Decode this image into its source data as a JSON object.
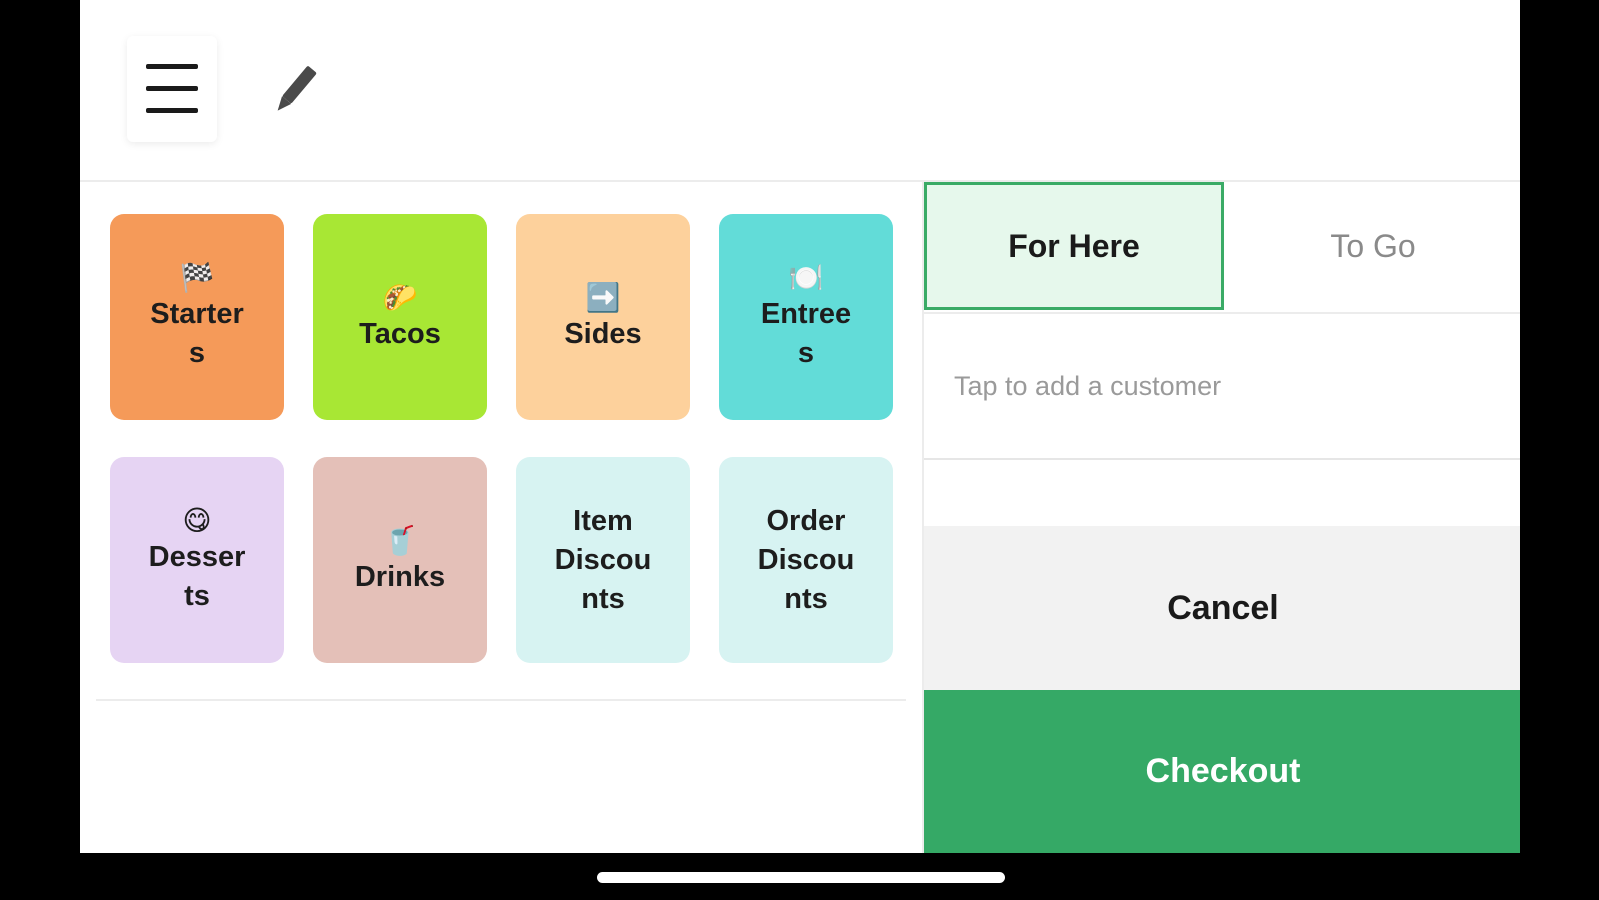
{
  "header": {
    "menu_icon": "hamburger-menu-icon",
    "edit_icon": "pencil-icon"
  },
  "tiles": [
    {
      "emoji": "🏁",
      "label": "Starter\ns",
      "color": "#f59a59"
    },
    {
      "emoji": "🌮",
      "label": "Tacos",
      "color": "#a8e734"
    },
    {
      "emoji": "➡️",
      "label": "Sides",
      "color": "#fdd19c"
    },
    {
      "emoji": "🍽️",
      "label": "Entree\ns",
      "color": "#62dcd8"
    },
    {
      "emoji": "😋",
      "label": "Desser\nts",
      "color": "#e6d4f3"
    },
    {
      "emoji": "🥤",
      "label": "Drinks",
      "color": "#e4c0b8"
    },
    {
      "emoji": "",
      "label": "Item\nDiscou\nnts",
      "color": "#d7f3f2"
    },
    {
      "emoji": "",
      "label": "Order\nDiscou\nnts",
      "color": "#d7f3f2"
    }
  ],
  "order": {
    "for_here_label": "For Here",
    "to_go_label": "To Go",
    "customer_placeholder": "Tap to add a customer",
    "cancel_label": "Cancel",
    "checkout_label": "Checkout"
  },
  "colors": {
    "accent": "#35a966",
    "active_toggle_bg": "#e6f8ec"
  }
}
